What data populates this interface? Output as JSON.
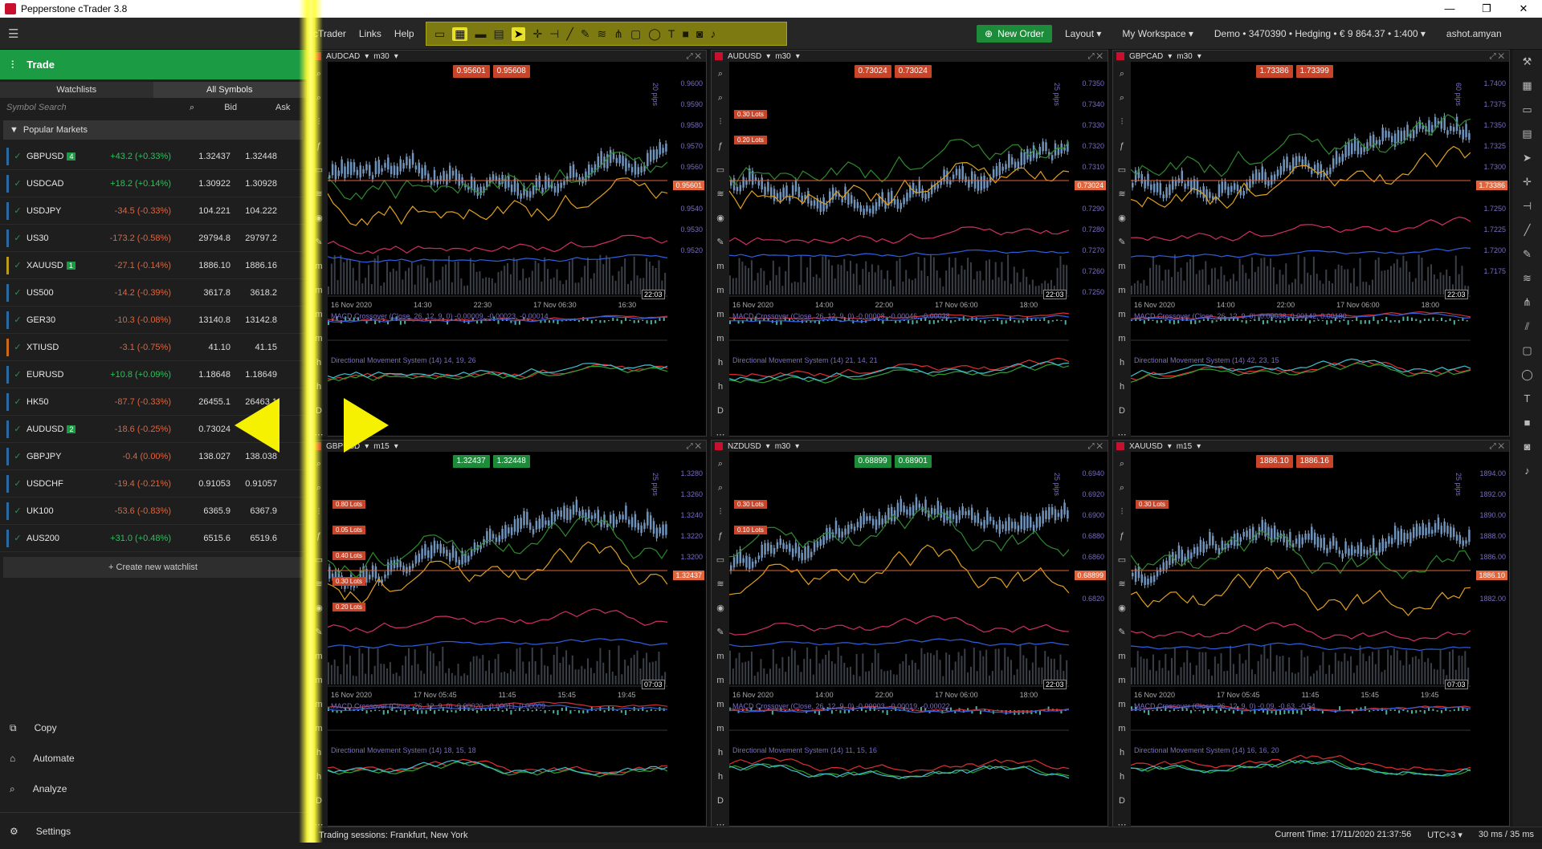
{
  "app": {
    "title": "Pepperstone cTrader 3.8"
  },
  "menu": {
    "ctrader": "cTrader",
    "links": "Links",
    "help": "Help"
  },
  "toolbar": {
    "new_order": "New Order",
    "layout": "Layout",
    "workspace": "My Workspace",
    "account": "Demo • 3470390 • Hedging • € 9 864.37 • 1:400",
    "user": "ashot.amyan"
  },
  "left_panel": {
    "header": "Trade",
    "tabs": [
      "Watchlists",
      "All Symbols"
    ],
    "search_placeholder": "Symbol Search",
    "col_bid": "Bid",
    "col_ask": "Ask",
    "group": "Popular Markets",
    "symbols": [
      {
        "name": "GBPUSD",
        "badge": "4",
        "change": "+43.2 (+0.33%)",
        "bid": "1.32437",
        "ask": "1.32448",
        "dir": "pos",
        "bar": "#2b6aa0"
      },
      {
        "name": "USDCAD",
        "badge": "",
        "change": "+18.2 (+0.14%)",
        "bid": "1.30922",
        "ask": "1.30928",
        "dir": "pos",
        "bar": "#2b6aa0"
      },
      {
        "name": "USDJPY",
        "badge": "",
        "change": "-34.5 (-0.33%)",
        "bid": "104.221",
        "ask": "104.222",
        "dir": "neg",
        "bar": "#2b6aa0"
      },
      {
        "name": "US30",
        "badge": "",
        "change": "-173.2 (-0.58%)",
        "bid": "29794.8",
        "ask": "29797.2",
        "dir": "neg",
        "bar": "#2b6aa0"
      },
      {
        "name": "XAUUSD",
        "badge": "1",
        "change": "-27.1 (-0.14%)",
        "bid": "1886.10",
        "ask": "1886.16",
        "dir": "neg",
        "bar": "#b99a1a"
      },
      {
        "name": "US500",
        "badge": "",
        "change": "-14.2 (-0.39%)",
        "bid": "3617.8",
        "ask": "3618.2",
        "dir": "neg",
        "bar": "#2b6aa0"
      },
      {
        "name": "GER30",
        "badge": "",
        "change": "-10.3 (-0.08%)",
        "bid": "13140.8",
        "ask": "13142.8",
        "dir": "neg",
        "bar": "#2b6aa0"
      },
      {
        "name": "XTIUSD",
        "badge": "",
        "change": "-3.1 (-0.75%)",
        "bid": "41.10",
        "ask": "41.15",
        "dir": "neg",
        "bar": "#c86a1a"
      },
      {
        "name": "EURUSD",
        "badge": "",
        "change": "+10.8 (+0.09%)",
        "bid": "1.18648",
        "ask": "1.18649",
        "dir": "pos",
        "bar": "#2b6aa0"
      },
      {
        "name": "HK50",
        "badge": "",
        "change": "-87.7 (-0.33%)",
        "bid": "26455.1",
        "ask": "26463.1",
        "dir": "neg",
        "bar": "#2b6aa0"
      },
      {
        "name": "AUDUSD",
        "badge": "2",
        "change": "-18.6 (-0.25%)",
        "bid": "0.73024",
        "ask": "0.73024",
        "dir": "neg",
        "bar": "#2b6aa0"
      },
      {
        "name": "GBPJPY",
        "badge": "",
        "change": "-0.4 (0.00%)",
        "bid": "138.027",
        "ask": "138.038",
        "dir": "neg",
        "bar": "#2b6aa0"
      },
      {
        "name": "USDCHF",
        "badge": "",
        "change": "-19.4 (-0.21%)",
        "bid": "0.91053",
        "ask": "0.91057",
        "dir": "neg",
        "bar": "#2b6aa0"
      },
      {
        "name": "UK100",
        "badge": "",
        "change": "-53.6 (-0.83%)",
        "bid": "6365.9",
        "ask": "6367.9",
        "dir": "neg",
        "bar": "#2b6aa0"
      },
      {
        "name": "AUS200",
        "badge": "",
        "change": "+31.0 (+0.48%)",
        "bid": "6515.6",
        "ask": "6519.6",
        "dir": "pos",
        "bar": "#2b6aa0"
      }
    ],
    "create_watchlist": "+ Create new watchlist",
    "nav": [
      "Copy",
      "Automate",
      "Analyze",
      "Settings"
    ]
  },
  "charts": [
    {
      "symbol": "AUDCAD",
      "tf": "m30",
      "sell": "0.95601",
      "buy": "0.95608",
      "color": "red",
      "last": "0.95601",
      "time": "22:03",
      "dates": [
        "16 Nov 2020",
        "14:30",
        "22:30",
        "17 Nov 06:30",
        "16:30"
      ],
      "yticks": [
        "0.9600",
        "0.9590",
        "0.9580",
        "0.9570",
        "0.9560",
        "0.9550",
        "0.9540",
        "0.9530",
        "0.9520"
      ],
      "macd": "MACD Crossover (Close, 26, 12, 9, 0) -0.00009, -0.00023, -0.00014",
      "dms": "Directional Movement System (14) 14, 19, 26",
      "pips": "20 pips",
      "lots": []
    },
    {
      "symbol": "AUDUSD",
      "tf": "m30",
      "sell": "0.73024",
      "buy": "0.73024",
      "color": "red",
      "last": "0.73024",
      "time": "22:03",
      "dates": [
        "16 Nov 2020",
        "14:00",
        "22:00",
        "17 Nov 06:00",
        "18:00"
      ],
      "yticks": [
        "0.7350",
        "0.7340",
        "0.7330",
        "0.7320",
        "0.7310",
        "0.7300",
        "0.7290",
        "0.7280",
        "0.7270",
        "0.7260",
        "0.7250"
      ],
      "macd": "MACD Crossover (Close, 26, 12, 9, 0) -0.00008, -0.00046, -0.00038",
      "dms": "Directional Movement System (14) 21, 14, 21",
      "pips": "25 pips",
      "lots": [
        "0.30 Lots",
        "0.20 Lots"
      ]
    },
    {
      "symbol": "GBPCAD",
      "tf": "m30",
      "sell": "1.73386",
      "buy": "1.73399",
      "color": "red",
      "last": "1.73386",
      "time": "22:03",
      "dates": [
        "16 Nov 2020",
        "14:00",
        "22:00",
        "17 Nov 06:00",
        "18:00"
      ],
      "yticks": [
        "1.7400",
        "1.7375",
        "1.7350",
        "1.7325",
        "1.7300",
        "1.7275",
        "1.7250",
        "1.7225",
        "1.7200",
        "1.7175"
      ],
      "macd": "MACD Crossover (Close, 26, 12, 9, 0) -0.00038, 0.00142, 0.00180",
      "dms": "Directional Movement System (14) 42, 23, 15",
      "pips": "60 pips",
      "lots": []
    },
    {
      "symbol": "GBPUSD",
      "tf": "m15",
      "sell": "1.32437",
      "buy": "1.32448",
      "color": "green",
      "last": "1.32437",
      "time": "07:03",
      "dates": [
        "16 Nov 2020",
        "17 Nov 05:45",
        "11:45",
        "15:45",
        "19:45"
      ],
      "yticks": [
        "1.3280",
        "1.3260",
        "1.3240",
        "1.3220",
        "1.3200",
        "1.3180"
      ],
      "macd": "MACD Crossover (Close, 26, 12, 9, 0) -0.00020, -0.00011, 0.00009",
      "dms": "Directional Movement System (14) 18, 15, 18",
      "pips": "25 pips",
      "lots": [
        "0.80 Lots",
        "0.05 Lots",
        "0.40 Lots",
        "0.30 Lots",
        "0.20 Lots"
      ]
    },
    {
      "symbol": "NZDUSD",
      "tf": "m30",
      "sell": "0.68899",
      "buy": "0.68901",
      "color": "green",
      "last": "0.68899",
      "time": "22:03",
      "dates": [
        "16 Nov 2020",
        "14:00",
        "22:00",
        "17 Nov 06:00",
        "18:00"
      ],
      "yticks": [
        "0.6940",
        "0.6920",
        "0.6900",
        "0.6880",
        "0.6860",
        "0.6840",
        "0.6820"
      ],
      "macd": "MACD Crossover (Close, 26, 12, 9, 0) -0.00003, -0.00019, -0.00022",
      "dms": "Directional Movement System (14) 11, 15, 16",
      "pips": "25 pips",
      "lots": [
        "0.30 Lots",
        "0.10 Lots"
      ]
    },
    {
      "symbol": "XAUUSD",
      "tf": "m15",
      "sell": "1886.10",
      "buy": "1886.16",
      "color": "red",
      "last": "1886.10",
      "time": "07:03",
      "dates": [
        "16 Nov 2020",
        "17 Nov 05:45",
        "11:45",
        "15:45",
        "19:45"
      ],
      "yticks": [
        "1894.00",
        "1892.00",
        "1890.00",
        "1888.00",
        "1886.00",
        "1884.00",
        "1882.00"
      ],
      "macd": "MACD Crossover (Close, 26, 12, 9, 0) -0.09, -0.63, -0.54",
      "dms": "Directional Movement System (14) 16, 16, 20",
      "pips": "25 pips",
      "lots": [
        "0.30 Lots"
      ]
    }
  ],
  "statusbar": {
    "sessions": "Trading sessions: Frankfurt, New York",
    "time": "Current Time: 17/11/2020 21:37:56",
    "tz": "UTC+3",
    "latency": "30 ms / 35 ms"
  },
  "colors": {
    "accent": "#1c9b45",
    "sell": "#c8452a",
    "highlight": "#f5f100"
  }
}
